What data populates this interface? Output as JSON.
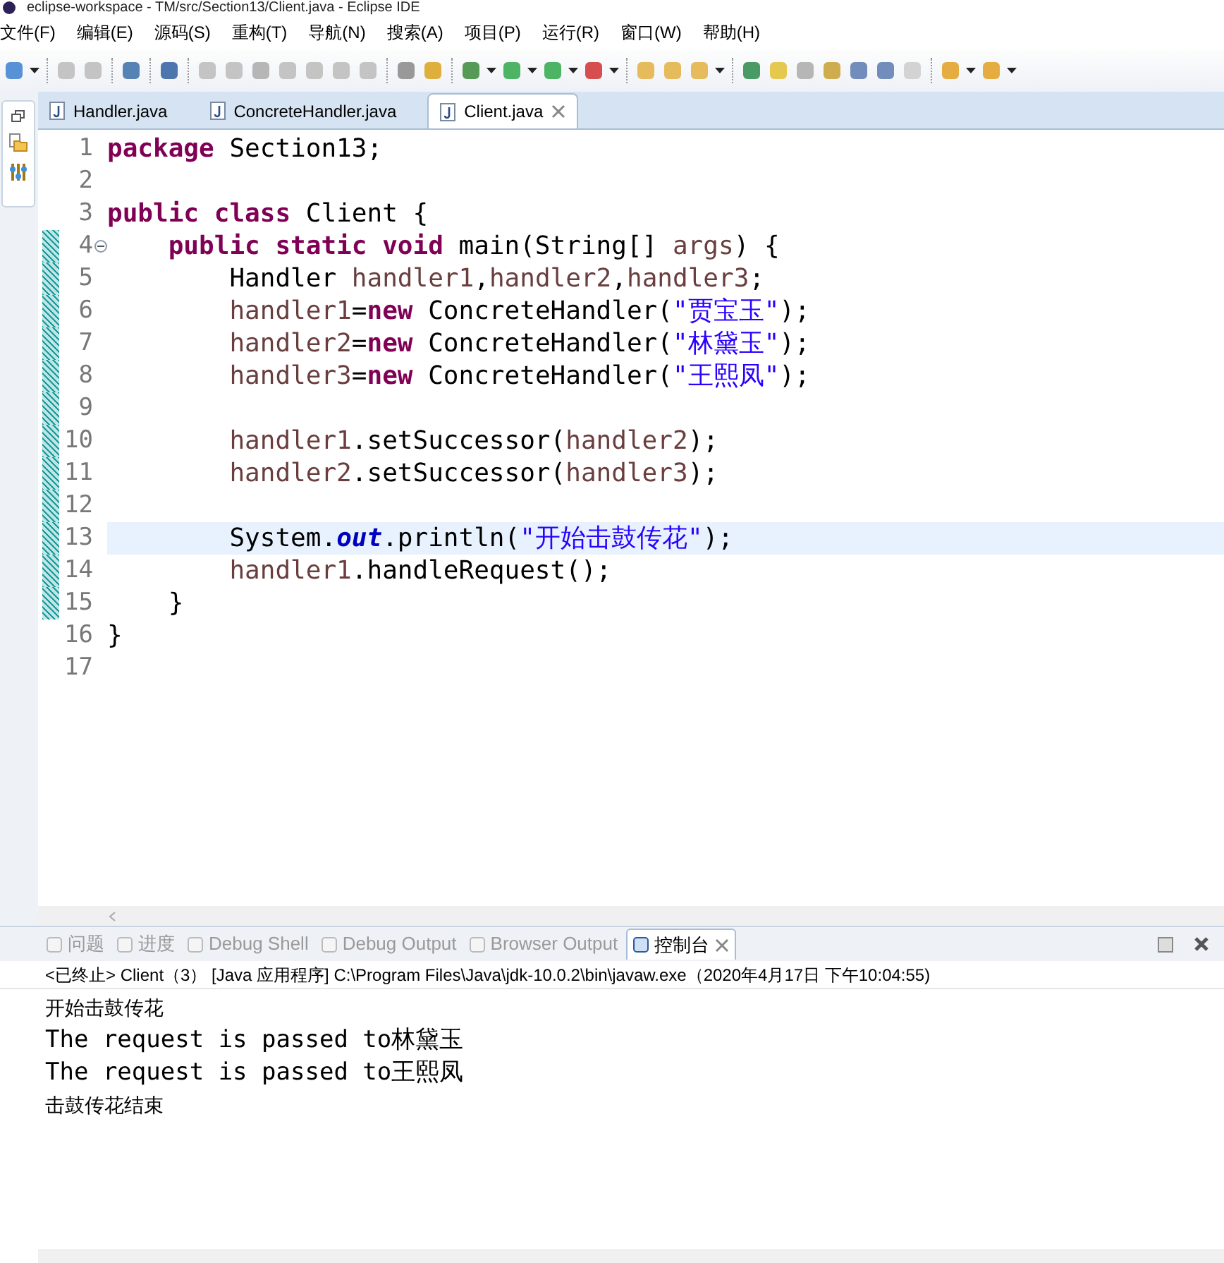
{
  "window": {
    "title": "eclipse-workspace - TM/src/Section13/Client.java - Eclipse IDE"
  },
  "menu": [
    "文件(F)",
    "编辑(E)",
    "源码(S)",
    "重构(T)",
    "导航(N)",
    "搜索(A)",
    "项目(P)",
    "运行(R)",
    "窗口(W)",
    "帮助(H)"
  ],
  "editor_tabs": [
    {
      "label": "Handler.java",
      "selected": false
    },
    {
      "label": "ConcreteHandler.java",
      "selected": false
    },
    {
      "label": "Client.java",
      "selected": true
    }
  ],
  "editor": {
    "lines": [
      {
        "number": "1",
        "changed": false,
        "current": false,
        "tokens": [
          {
            "kind": "keyword",
            "text": "package "
          },
          {
            "kind": "plain",
            "text": "Section13;"
          }
        ]
      },
      {
        "number": "2",
        "changed": false,
        "current": false
      },
      {
        "number": "3",
        "changed": false,
        "current": false,
        "tokens": [
          {
            "kind": "keyword",
            "text": "public class "
          },
          {
            "kind": "plain",
            "text": "Client {"
          }
        ]
      },
      {
        "number": "4",
        "changed": true,
        "current": false,
        "fold_collapsed": false,
        "tokens": [
          {
            "kind": "keyword",
            "text": "    public static void "
          },
          {
            "kind": "plain",
            "text": "main(String[] "
          },
          {
            "kind": "variable",
            "text": "args"
          },
          {
            "kind": "plain",
            "text": ") {"
          }
        ]
      },
      {
        "number": "5",
        "changed": true,
        "current": false,
        "tokens": [
          {
            "kind": "plain",
            "text": "        Handler "
          },
          {
            "kind": "variable",
            "text": "handler1"
          },
          {
            "kind": "plain",
            "text": ","
          },
          {
            "kind": "variable",
            "text": "handler2"
          },
          {
            "kind": "plain",
            "text": ","
          },
          {
            "kind": "variable",
            "text": "handler3"
          },
          {
            "kind": "plain",
            "text": ";"
          }
        ]
      },
      {
        "number": "6",
        "changed": true,
        "current": false,
        "tokens": [
          {
            "kind": "variable",
            "text": "        handler1"
          },
          {
            "kind": "plain",
            "text": "="
          },
          {
            "kind": "keyword",
            "text": "new"
          },
          {
            "kind": "plain",
            "text": " ConcreteHandler("
          },
          {
            "kind": "string",
            "text": "\"贾宝玉\""
          },
          {
            "kind": "plain",
            "text": ");"
          }
        ]
      },
      {
        "number": "7",
        "changed": true,
        "current": false,
        "tokens": [
          {
            "kind": "variable",
            "text": "        handler2"
          },
          {
            "kind": "plain",
            "text": "="
          },
          {
            "kind": "keyword",
            "text": "new"
          },
          {
            "kind": "plain",
            "text": " ConcreteHandler("
          },
          {
            "kind": "string",
            "text": "\"林黛玉\""
          },
          {
            "kind": "plain",
            "text": ");"
          }
        ]
      },
      {
        "number": "8",
        "changed": true,
        "current": false,
        "tokens": [
          {
            "kind": "variable",
            "text": "        handler3"
          },
          {
            "kind": "plain",
            "text": "="
          },
          {
            "kind": "keyword",
            "text": "new"
          },
          {
            "kind": "plain",
            "text": " ConcreteHandler("
          },
          {
            "kind": "string",
            "text": "\"王熙凤\""
          },
          {
            "kind": "plain",
            "text": ");"
          }
        ]
      },
      {
        "number": "9",
        "changed": true,
        "current": false
      },
      {
        "number": "10",
        "changed": true,
        "current": false,
        "tokens": [
          {
            "kind": "variable",
            "text": "        handler1"
          },
          {
            "kind": "plain",
            "text": ".setSuccessor("
          },
          {
            "kind": "variable",
            "text": "handler2"
          },
          {
            "kind": "plain",
            "text": ");"
          }
        ]
      },
      {
        "number": "11",
        "changed": true,
        "current": false,
        "tokens": [
          {
            "kind": "variable",
            "text": "        handler2"
          },
          {
            "kind": "plain",
            "text": ".setSuccessor("
          },
          {
            "kind": "variable",
            "text": "handler3"
          },
          {
            "kind": "plain",
            "text": ");"
          }
        ]
      },
      {
        "number": "12",
        "changed": true,
        "current": false
      },
      {
        "number": "13",
        "changed": true,
        "current": true,
        "tokens": [
          {
            "kind": "plain",
            "text": "        System."
          },
          {
            "kind": "field",
            "text": "out"
          },
          {
            "kind": "plain",
            "text": ".println("
          },
          {
            "kind": "string",
            "text": "\"开始击鼓传花\""
          },
          {
            "kind": "plain",
            "text": ");"
          }
        ]
      },
      {
        "number": "14",
        "changed": true,
        "current": false,
        "tokens": [
          {
            "kind": "variable",
            "text": "        handler1"
          },
          {
            "kind": "plain",
            "text": ".handleRequest();"
          }
        ]
      },
      {
        "number": "15",
        "changed": true,
        "current": false,
        "tokens": [
          {
            "kind": "plain",
            "text": "    }"
          }
        ]
      },
      {
        "number": "16",
        "changed": false,
        "current": false,
        "tokens": [
          {
            "kind": "plain",
            "text": "}"
          }
        ]
      },
      {
        "number": "17",
        "changed": false,
        "current": false
      }
    ]
  },
  "console_tabs": [
    {
      "label": "问题",
      "selected": false
    },
    {
      "label": "进度",
      "selected": false
    },
    {
      "label": "Debug Shell",
      "selected": false
    },
    {
      "label": "Debug Output",
      "selected": false
    },
    {
      "label": "Browser Output",
      "selected": false
    },
    {
      "label": "控制台",
      "selected": true
    }
  ],
  "console": {
    "status": "<已终止> Client（3） [Java 应用程序] C:\\Program Files\\Java\\jdk-10.0.2\\bin\\javaw.exe（2020年4月17日 下午10:04:55)",
    "output": [
      {
        "kind": "cjk",
        "text": "开始击鼓传花"
      },
      {
        "kind": "mono",
        "text": "The request is passed to林黛玉"
      },
      {
        "kind": "mono",
        "text": "The request is passed to王熙凤"
      },
      {
        "kind": "cjk",
        "text": "击鼓传花结束"
      }
    ]
  }
}
